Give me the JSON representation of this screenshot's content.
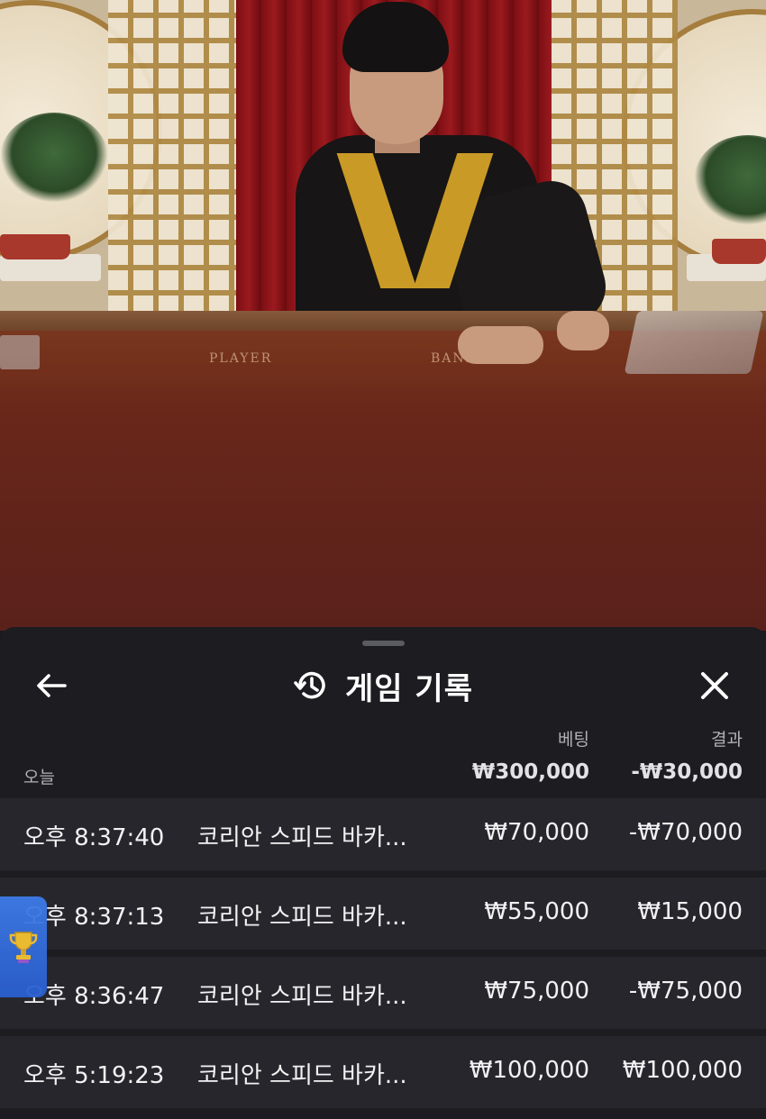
{
  "video": {
    "table_label_player": "PLAYER",
    "table_label_banker": "BANKER"
  },
  "sheet": {
    "title": "게임 기록",
    "icons": {
      "back": "arrow-left-icon",
      "history": "history-clock-icon",
      "close": "close-x-icon",
      "trophy": "trophy-icon"
    },
    "columns": {
      "bet": "베팅",
      "result": "결과"
    },
    "summary": {
      "label": "오늘",
      "total_bet": "₩300,000",
      "total_result": "-₩30,000"
    },
    "rows": [
      {
        "time": "오후 8:37:40",
        "game": "코리안 스피드 바카...",
        "bet": "₩70,000",
        "result": "-₩70,000"
      },
      {
        "time": "오후 8:37:13",
        "game": "코리안 스피드 바카...",
        "bet": "₩55,000",
        "result": "₩15,000"
      },
      {
        "time": "오후 8:36:47",
        "game": "코리안 스피드 바카...",
        "bet": "₩75,000",
        "result": "-₩75,000"
      },
      {
        "time": "오후 5:19:23",
        "game": "코리안 스피드 바카...",
        "bet": "₩100,000",
        "result": "₩100,000"
      }
    ]
  },
  "colors": {
    "sheet_bg": "#1c1c21",
    "row_bg": "#26262c",
    "trophy_button": "#2f68dc"
  }
}
